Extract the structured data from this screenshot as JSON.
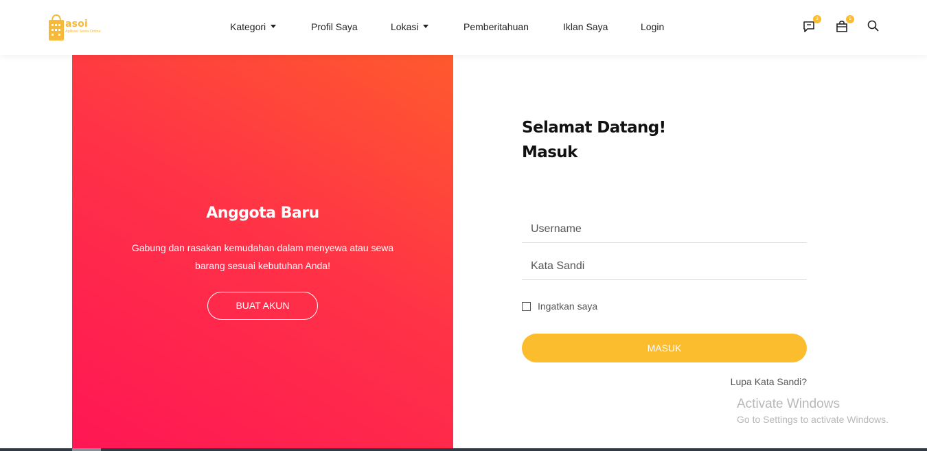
{
  "brand": {
    "name": "asoi",
    "tagline": "Aplikasi Sewa Online",
    "color": "#f6b93b"
  },
  "nav": {
    "items": [
      {
        "label": "Kategori",
        "dropdown": true
      },
      {
        "label": "Profil Saya",
        "dropdown": false
      },
      {
        "label": "Lokasi",
        "dropdown": true
      },
      {
        "label": "Pemberitahuan",
        "dropdown": false
      },
      {
        "label": "Iklan Saya",
        "dropdown": false
      },
      {
        "label": "Login",
        "dropdown": false
      }
    ]
  },
  "header_icons": {
    "chat": {
      "icon": "chat-icon",
      "badge": "3"
    },
    "cart": {
      "icon": "bag-icon",
      "badge": "5"
    },
    "search": {
      "icon": "search-icon"
    }
  },
  "signup_panel": {
    "title": "Anggota Baru",
    "description": "Gabung dan rasakan kemudahan dalam menyewa atau sewa barang sesuai kebutuhan Anda!",
    "button_label": "BUAT AKUN",
    "gradient": [
      "#ff1654",
      "#ff5a2d"
    ]
  },
  "login": {
    "greeting": "Selamat Datang!",
    "heading": "Masuk",
    "username_placeholder": "Username",
    "password_placeholder": "Kata Sandi",
    "remember_label": "Ingatkan saya",
    "submit_label": "MASUK",
    "forgot_label": "Lupa Kata Sandi?",
    "accent": "#fbbc2d"
  },
  "watermark": {
    "title": "Activate Windows",
    "subtitle": "Go to Settings to activate Windows."
  }
}
